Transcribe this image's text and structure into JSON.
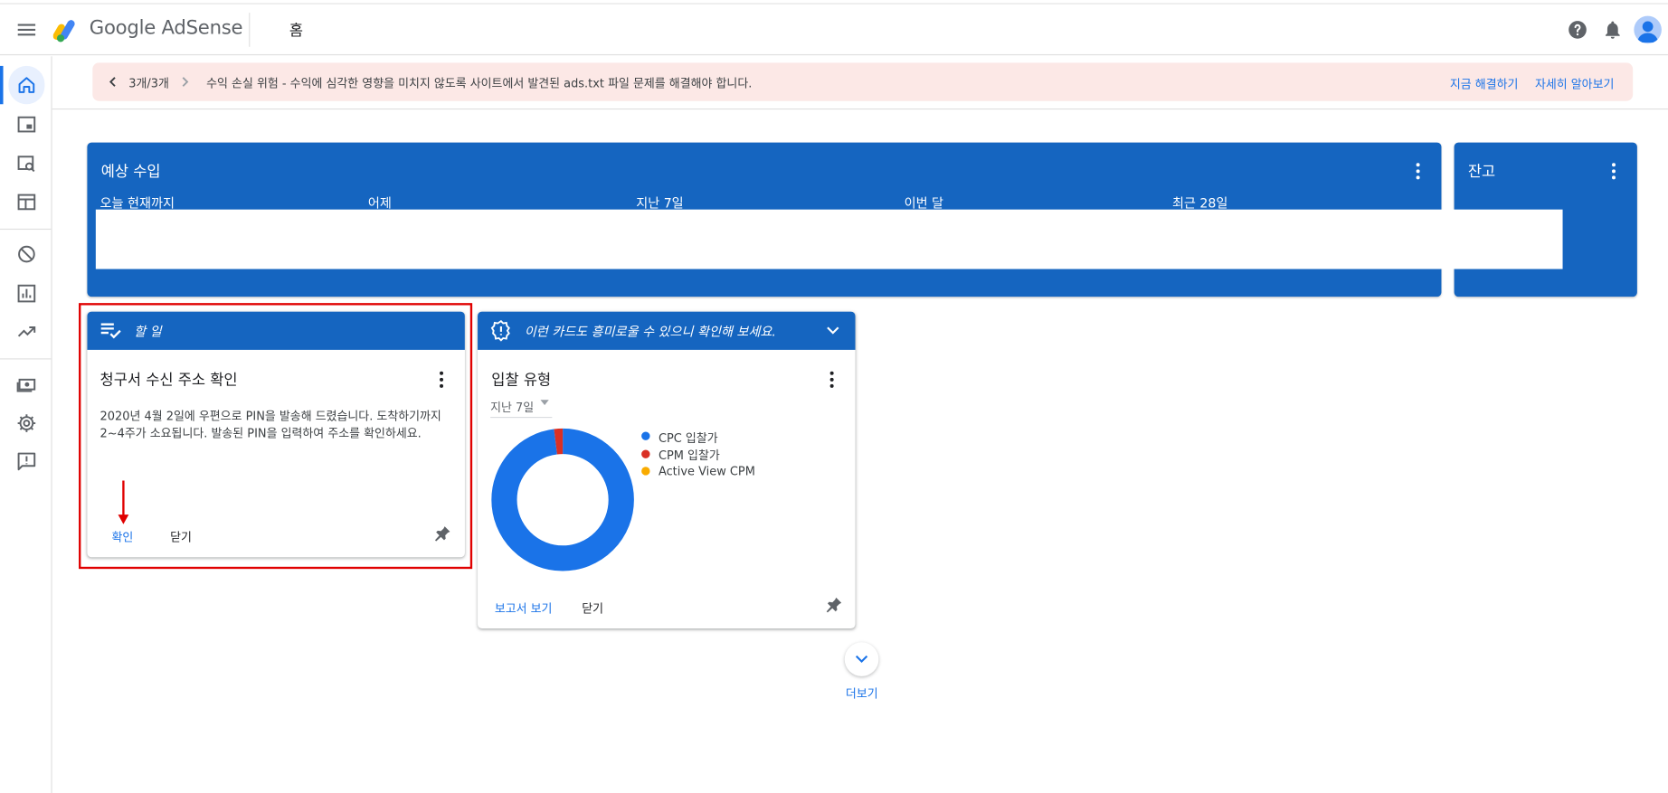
{
  "app": {
    "name": "Google AdSense",
    "page_title": "홈"
  },
  "header": {
    "icons": [
      "menu-icon",
      "help-icon",
      "notifications-icon",
      "account-avatar"
    ]
  },
  "sidebar": {
    "items": [
      "home-icon",
      "ads-icon",
      "site-search-icon",
      "web-layout-icon",
      "block-icon",
      "reports-icon",
      "optimization-icon",
      "payments-icon",
      "settings-icon",
      "feedback-icon"
    ]
  },
  "banner": {
    "counter": "3개/3개",
    "message": "수익 손실 위험 - 수익에 심각한 영향을 미치지 않도록 사이트에서 발견된 ads.txt 파일 문제를 해결해야 합니다.",
    "fix_link": "지금 해결하기",
    "learn_link": "자세히 알아보기"
  },
  "earnings": {
    "title": "예상 수입",
    "columns": [
      "오늘 현재까지",
      "어제",
      "지난 7일",
      "이번 달",
      "최근 28일"
    ]
  },
  "balance": {
    "title": "잔고"
  },
  "todo_card": {
    "header": "할 일",
    "title": "청구서 수신 주소 확인",
    "body": "2020년 4월 2일에 우편으로 PIN을 발송해 드렸습니다. 도착하기까지 2~4주가 소요됩니다. 발송된 PIN을 입력하여 주소를 확인하세요.",
    "confirm_label": "확인",
    "close_label": "닫기"
  },
  "bid_card": {
    "header": "이런 카드도 흥미로울 수 있으니 확인해 보세요.",
    "title": "입찰 유형",
    "period": "지난 7일",
    "report_label": "보고서 보기",
    "close_label": "닫기",
    "legend": [
      {
        "label": "CPC 입찰가",
        "color": "#1a73e8"
      },
      {
        "label": "CPM 입찰가",
        "color": "#d93025"
      },
      {
        "label": "Active View CPM",
        "color": "#f9ab00"
      }
    ]
  },
  "chart_data": {
    "type": "pie",
    "slices": [
      {
        "label": "CPC 입찰가",
        "value": 98,
        "color": "#1a73e8"
      },
      {
        "label": "CPM 입찰가",
        "value": 2,
        "color": "#d93025"
      },
      {
        "label": "Active View CPM",
        "value": 0,
        "color": "#f9ab00"
      }
    ],
    "donut": true
  },
  "more": {
    "label": "더보기"
  }
}
